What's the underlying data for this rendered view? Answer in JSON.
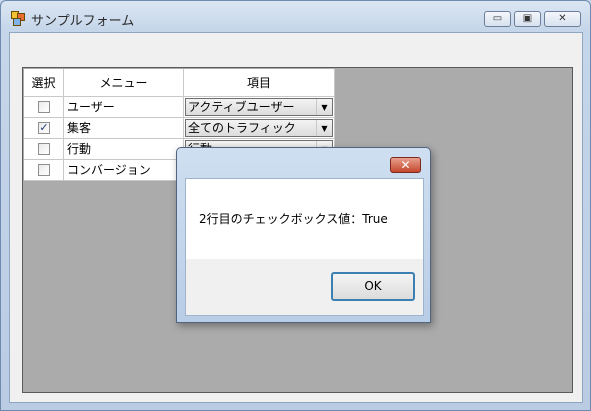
{
  "window": {
    "title": "サンプルフォーム",
    "controls": {
      "minimize": "▭",
      "maximize": "▣",
      "close": "✕"
    }
  },
  "grid": {
    "headers": {
      "select": "選択",
      "menu": "メニュー",
      "item": "項目"
    },
    "rows": [
      {
        "checked": false,
        "check_mark": "",
        "menu": "ユーザー",
        "item": "アクティブユーザー"
      },
      {
        "checked": true,
        "check_mark": "✓",
        "menu": "集客",
        "item": "全てのトラフィック"
      },
      {
        "checked": false,
        "check_mark": "",
        "menu": "行動",
        "item": "行動"
      },
      {
        "checked": false,
        "check_mark": "",
        "menu": "コンバージョン",
        "item": ""
      }
    ],
    "dropdown_arrow": "▼"
  },
  "dialog": {
    "close": "✕",
    "message": "2行目のチェックボックス値：True",
    "ok_label": "OK"
  },
  "colors": {
    "grid_background": "#ababab",
    "dialog_close": "#c4472c",
    "ok_focus_border": "#3c7fb1"
  }
}
